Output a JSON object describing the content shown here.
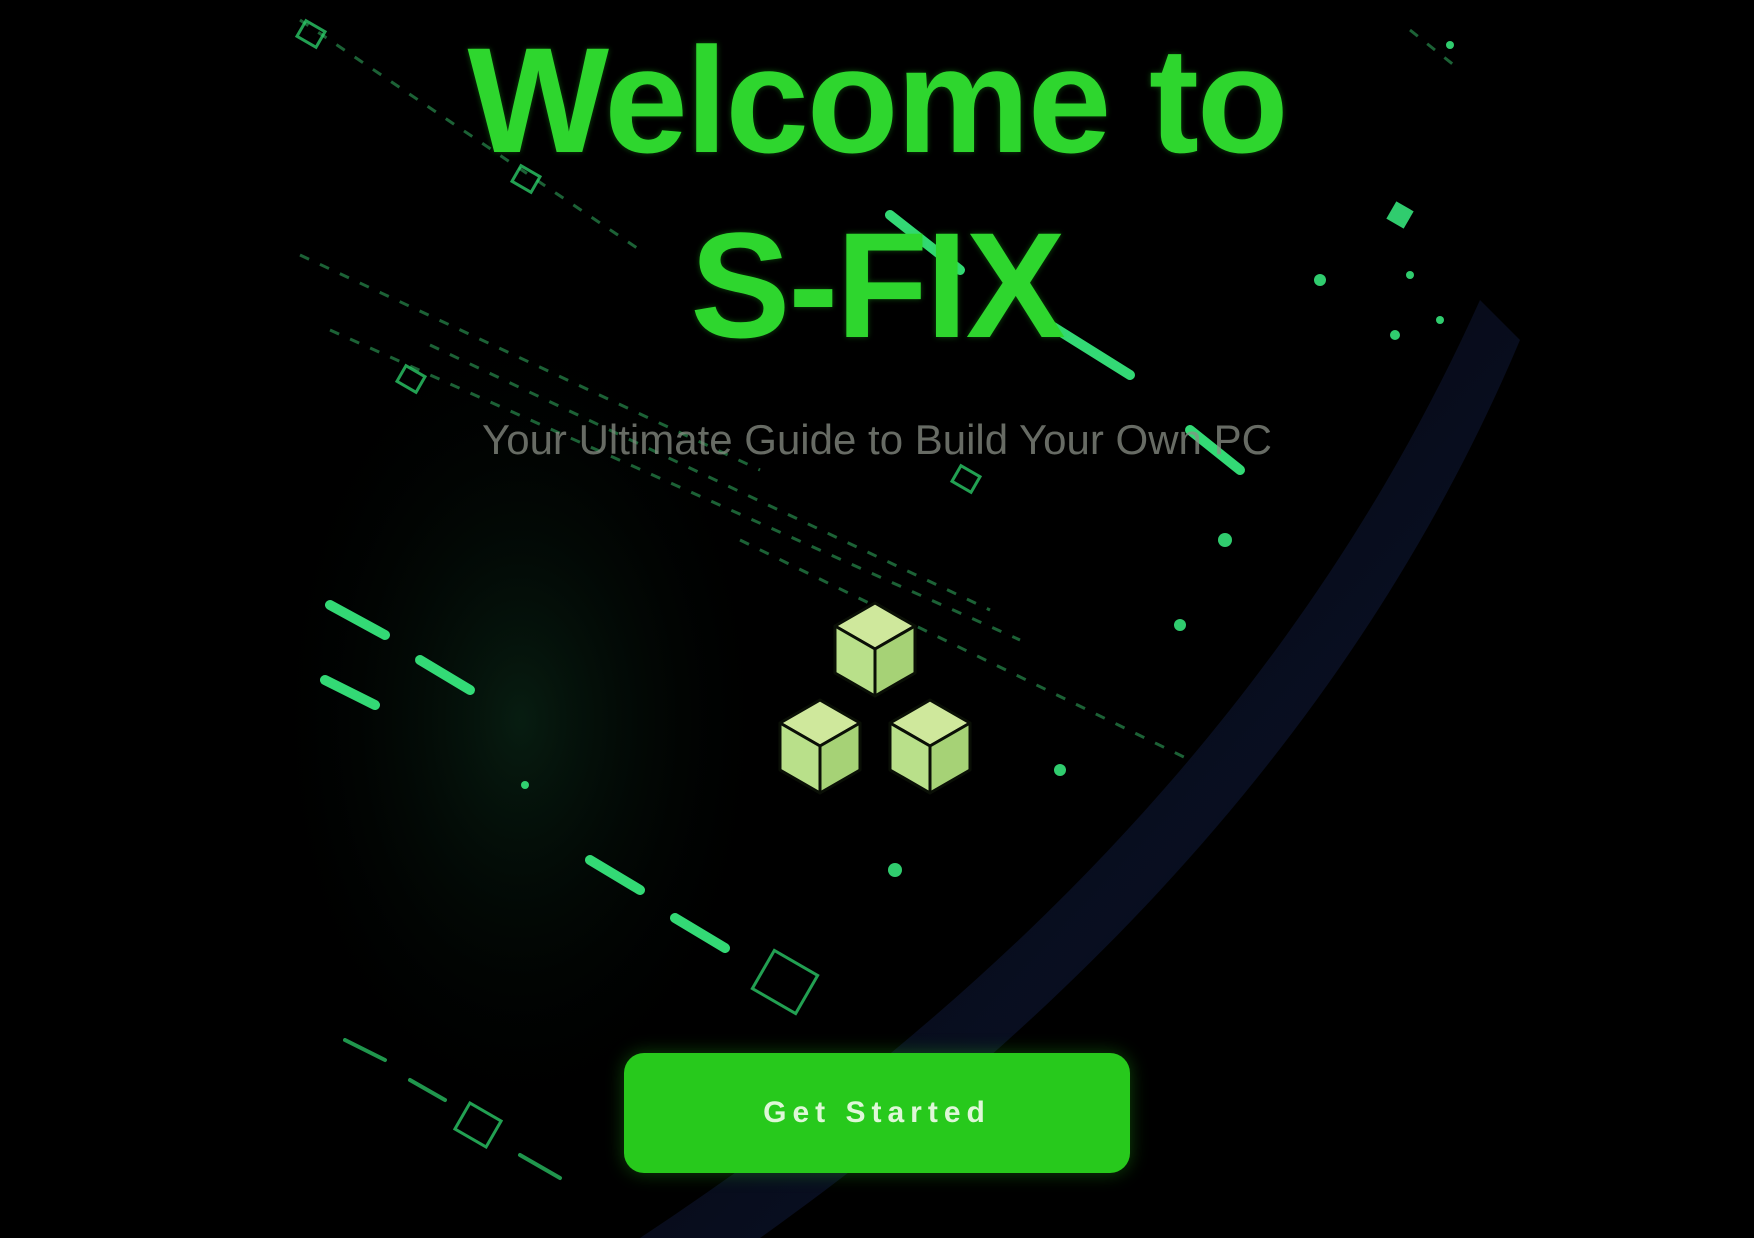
{
  "welcome": {
    "title_line1": "Welcome to",
    "title_line2": "S-FIX",
    "subtitle": "Your Ultimate Guide to Build Your Own PC",
    "cta_label": "Get Started"
  },
  "icons": {
    "logo": "three-cubes-icon"
  },
  "colors": {
    "background": "#000000",
    "title": "#2ed62e",
    "subtitle": "#8a8f86",
    "button": "#27c91c",
    "button_text": "#dff7d8",
    "accent_glow": "#3cff8a",
    "logo_fill": "#b9e08a"
  }
}
